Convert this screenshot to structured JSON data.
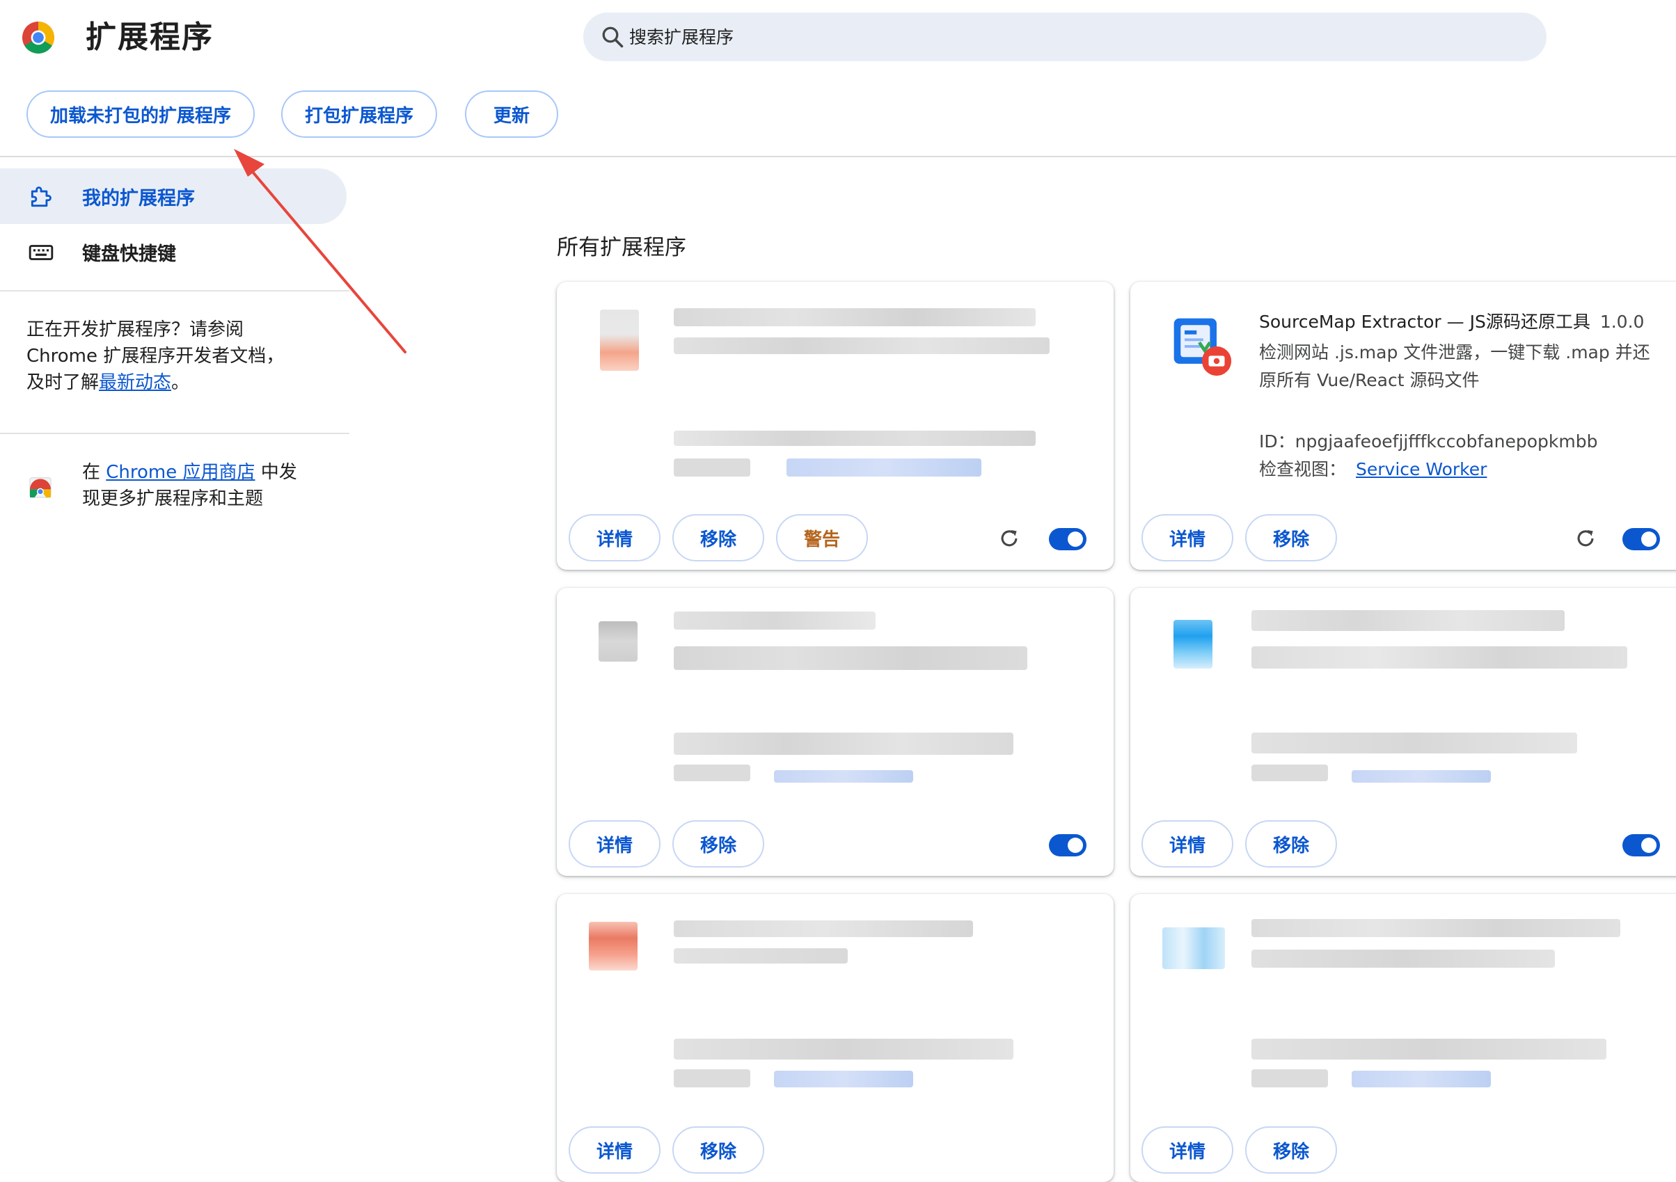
{
  "app": {
    "title": "扩展程序"
  },
  "search": {
    "placeholder": "搜索扩展程序"
  },
  "toolbar": {
    "load_unpacked": "加载未打包的扩展程序",
    "pack": "打包扩展程序",
    "update": "更新"
  },
  "sidebar": {
    "items": [
      {
        "label": "我的扩展程序",
        "icon": "puzzle-icon",
        "active": true
      },
      {
        "label": "键盘快捷键",
        "icon": "keyboard-icon",
        "active": false
      }
    ],
    "dev_text_1": "正在开发扩展程序？请参阅",
    "dev_text_2": "Chrome 扩展程序开发者文档，",
    "dev_text_3a": "及时了解",
    "dev_link": "最新动态",
    "dev_text_3b": "。",
    "store_prefix": "在 ",
    "store_link": "Chrome 应用商店",
    "store_suffix": " 中发",
    "store_text_2": "现更多扩展程序和主题"
  },
  "main": {
    "section_title": "所有扩展程序",
    "buttons": {
      "details": "详情",
      "remove": "移除",
      "warning": "警告"
    },
    "featured": {
      "name": "SourceMap Extractor — JS源码还原工具",
      "version": "1.0.0",
      "desc_line1": "检测网站 .js.map 文件泄露，一键下载 .map 并还",
      "desc_line2": "原所有 Vue/React 源码文件",
      "id": "ID：npgjaafeoefjjfffkccobfanepopkmbb",
      "view_label": "检查视图：",
      "view_link": "Service Worker"
    }
  },
  "colors": {
    "accent": "#0b57d0",
    "sidebar_active": "#e9eef6",
    "warning": "#b5651d",
    "annotation_arrow": "#e8453c"
  }
}
